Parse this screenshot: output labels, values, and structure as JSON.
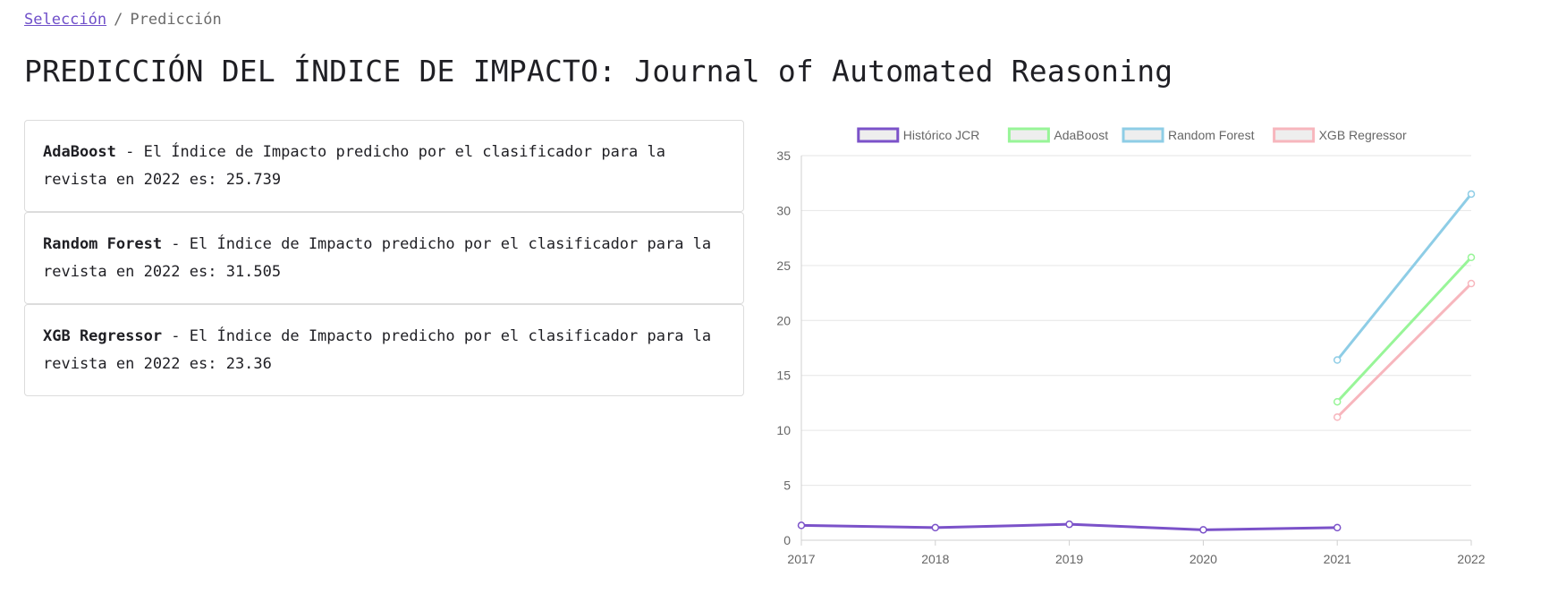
{
  "breadcrumb": {
    "link": "Selección",
    "separator": "/",
    "current": "Predicción"
  },
  "page_title": "PREDICCIÓN DEL ÍNDICE DE IMPACTO: Journal of Automated Reasoning",
  "cards": [
    {
      "model": "AdaBoost",
      "text_pre": " - El Índice de Impacto predicho por el clasificador para la revista en 2022 es: ",
      "value": "25.739"
    },
    {
      "model": "Random Forest",
      "text_pre": " - El Índice de Impacto predicho por el clasificador para la revista en 2022 es: ",
      "value": "31.505"
    },
    {
      "model": "XGB Regressor",
      "text_pre": " - El Índice de Impacto predicho por el clasificador para la revista en 2022 es: ",
      "value": "23.36"
    }
  ],
  "chart_data": {
    "type": "line",
    "categories": [
      "2017",
      "2018",
      "2019",
      "2020",
      "2021",
      "2022"
    ],
    "ylim": [
      0,
      35
    ],
    "yticks": [
      "0",
      "5",
      "10",
      "15",
      "20",
      "25",
      "30",
      "35"
    ],
    "legend_position": "top",
    "grid": true,
    "series": [
      {
        "name": "Histórico JCR",
        "color": "#7b52c9",
        "values": [
          1.35,
          1.15,
          1.45,
          0.95,
          1.15,
          null
        ]
      },
      {
        "name": "AdaBoost",
        "color": "#98f598",
        "values": [
          null,
          null,
          null,
          null,
          12.6,
          25.739
        ]
      },
      {
        "name": "Random Forest",
        "color": "#8ecde6",
        "values": [
          null,
          null,
          null,
          null,
          16.4,
          31.505
        ]
      },
      {
        "name": "XGB Regressor",
        "color": "#f7b6bd",
        "values": [
          null,
          null,
          null,
          null,
          11.2,
          23.36
        ]
      }
    ]
  }
}
